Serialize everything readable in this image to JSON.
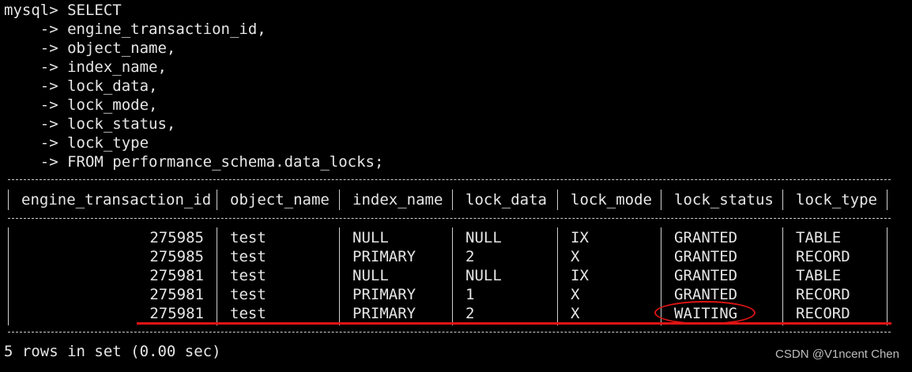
{
  "query_lines": [
    "mysql> SELECT",
    "    -> engine_transaction_id,",
    "    -> object_name,",
    "    -> index_name,",
    "    -> lock_data,",
    "    -> lock_mode,",
    "    -> lock_status,",
    "    -> lock_type",
    "    -> FROM performance_schema.data_locks;"
  ],
  "columns": [
    "engine_transaction_id",
    "object_name",
    "index_name",
    "lock_data",
    "lock_mode",
    "lock_status",
    "lock_type"
  ],
  "rows": [
    [
      "275985",
      "test",
      "NULL",
      "NULL",
      "IX",
      "GRANTED",
      "TABLE"
    ],
    [
      "275985",
      "test",
      "PRIMARY",
      "2",
      "X",
      "GRANTED",
      "RECORD"
    ],
    [
      "275981",
      "test",
      "NULL",
      "NULL",
      "IX",
      "GRANTED",
      "TABLE"
    ],
    [
      "275981",
      "test",
      "PRIMARY",
      "1",
      "X",
      "GRANTED",
      "RECORD"
    ],
    [
      "275981",
      "test",
      "PRIMARY",
      "2",
      "X",
      "WAITING",
      "RECORD"
    ]
  ],
  "status_text": "5 rows in set (0.00 sec)",
  "watermark": "CSDN @V1ncent Chen",
  "colors": {
    "background": "#000000",
    "text": "#e6e6e6",
    "annotation": "#e01414"
  }
}
